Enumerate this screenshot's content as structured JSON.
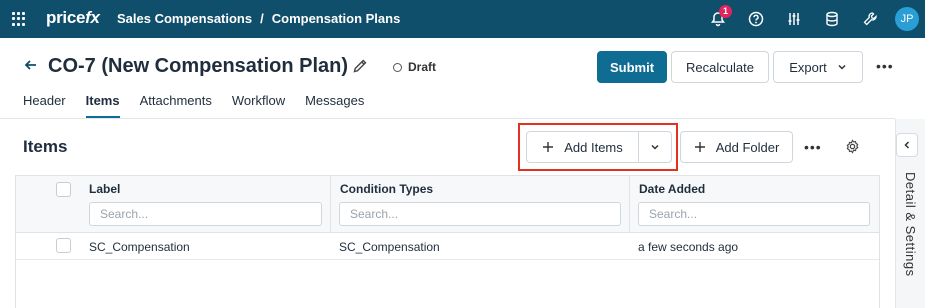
{
  "app": {
    "logo_main": "price",
    "logo_fx": "fx",
    "breadcrumb": [
      "Sales Compensations",
      "/",
      "Compensation Plans"
    ],
    "notification_count": "1",
    "user_initials": "JP",
    "nav_icons": [
      "bell-icon",
      "help-icon",
      "sliders-icon",
      "database-icon",
      "wrench-icon"
    ]
  },
  "page": {
    "title": "CO-7 (New Compensation Plan)",
    "status": "Draft",
    "actions": {
      "submit": "Submit",
      "recalculate": "Recalculate",
      "export": "Export"
    }
  },
  "tabs": [
    {
      "label": "Header",
      "active": false
    },
    {
      "label": "Items",
      "active": true
    },
    {
      "label": "Attachments",
      "active": false
    },
    {
      "label": "Workflow",
      "active": false
    },
    {
      "label": "Messages",
      "active": false
    }
  ],
  "items_section": {
    "title": "Items",
    "add_items": "Add Items",
    "add_folder": "Add Folder"
  },
  "side_panel": {
    "label": "Detail & Settings"
  },
  "table": {
    "columns": [
      {
        "label": "Label",
        "placeholder": "Search..."
      },
      {
        "label": "Condition Types",
        "placeholder": "Search..."
      },
      {
        "label": "Date Added",
        "placeholder": "Search..."
      }
    ],
    "rows": [
      {
        "label": "SC_Compensation",
        "condition_types": "SC_Compensation",
        "date_added": "a few seconds ago"
      }
    ]
  },
  "colors": {
    "navbar": "#0f4f6b",
    "primary": "#0f6c92",
    "highlight": "#e0321e",
    "badge": "#e0245e"
  }
}
